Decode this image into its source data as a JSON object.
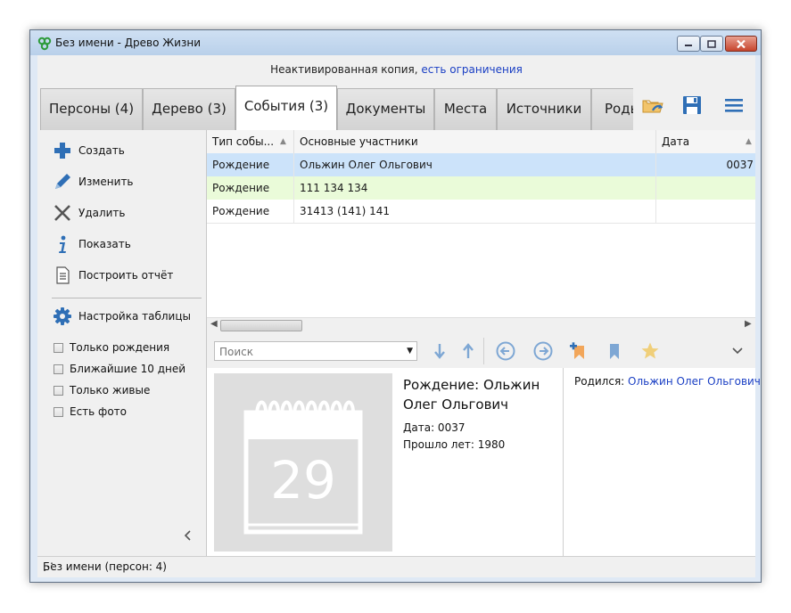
{
  "window": {
    "title": "Без имени - Древо Жизни"
  },
  "notice": {
    "text": "Неактивированная копия,",
    "link": "есть ограничения"
  },
  "tabs": [
    {
      "label": "Персоны (4)"
    },
    {
      "label": "Дерево (3)"
    },
    {
      "label": "События (3)",
      "active": true
    },
    {
      "label": "Документы"
    },
    {
      "label": "Места"
    },
    {
      "label": "Источники"
    },
    {
      "label": "Родь"
    }
  ],
  "toolbar_icons": [
    "open-folder-icon",
    "save-icon",
    "menu-icon"
  ],
  "actions": [
    {
      "label": "Создать",
      "icon": "plus-icon"
    },
    {
      "label": "Изменить",
      "icon": "pencil-icon"
    },
    {
      "label": "Удалить",
      "icon": "delete-x-icon"
    },
    {
      "label": "Показать",
      "icon": "info-icon"
    },
    {
      "label": "Построить отчёт",
      "icon": "report-icon"
    }
  ],
  "table_settings": {
    "label": "Настройка таблицы",
    "icon": "gear-icon"
  },
  "filters": [
    {
      "label": "Только рождения",
      "checked": false
    },
    {
      "label": "Ближайшие 10 дней",
      "checked": false
    },
    {
      "label": "Только живые",
      "checked": false
    },
    {
      "label": "Есть фото",
      "checked": false
    }
  ],
  "grid": {
    "columns": [
      "Тип собы...",
      "Основные участники",
      "Дата"
    ],
    "rows": [
      {
        "type": "Рождение",
        "participants": "Ольжин Олег Ольгович",
        "date": "0037",
        "state": "selected"
      },
      {
        "type": "Рождение",
        "participants": "111 134 134",
        "date": "",
        "state": "alt"
      },
      {
        "type": "Рождение",
        "participants": "31413 (141) 141",
        "date": "",
        "state": "normal"
      }
    ]
  },
  "search": {
    "placeholder": "Поиск"
  },
  "card": {
    "title": "Рождение: Ольжин Олег Ольгович",
    "date_line": "Дата: 0037",
    "years_line": "Прошло лет: 1980",
    "calendar_day": "29"
  },
  "relations": {
    "label": "Родился:",
    "person": "Ольжин Олег Ольгович"
  },
  "status": {
    "text": "Без имени (персон: 4)"
  },
  "colors": {
    "accent_blue": "#2f6fb6",
    "selected_row": "#cce3fa",
    "alt_row": "#eafbd9",
    "link": "#1a3fc4",
    "bookmark_orange": "#f2a65a",
    "star": "#f0cf7a"
  }
}
